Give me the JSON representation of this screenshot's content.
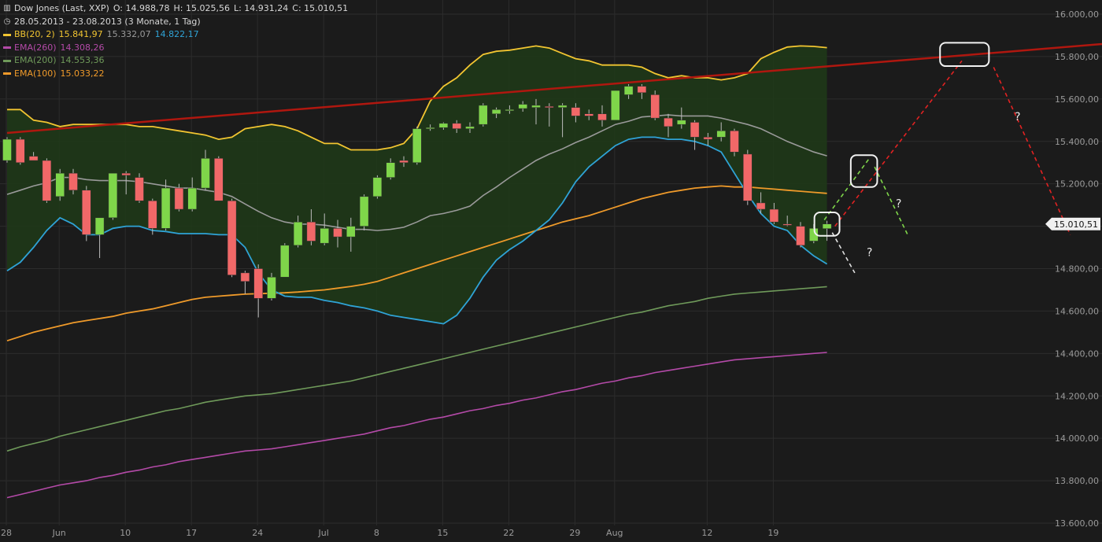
{
  "header": {
    "instrument": "Dow Jones (Last, XXP)",
    "o": "O: 14.988,78",
    "h": "H: 15.025,56",
    "l": "L: 14.931,24",
    "c": "C: 15.010,51",
    "period": "28.05.2013 - 23.08.2013 (3 Monate, 1 Tag)"
  },
  "indicators": [
    {
      "label": "BB(20, 2)",
      "values": [
        "15.841,97",
        "15.332,07",
        "14.822,17"
      ],
      "colors": [
        "#f2c531",
        "#9a9a9a",
        "#2fa3d6"
      ]
    },
    {
      "label": "EMA(260)",
      "values": [
        "14.308,26"
      ],
      "colors": [
        "#b44aa8"
      ]
    },
    {
      "label": "EMA(200)",
      "values": [
        "14.553,36"
      ],
      "colors": [
        "#6f9a5a"
      ]
    },
    {
      "label": "EMA(100)",
      "values": [
        "15.033,22"
      ],
      "colors": [
        "#ef9a2a"
      ]
    }
  ],
  "colors": {
    "background": "#1b1b1b",
    "grid": "#2c2c2c",
    "up": "#7fd64a",
    "down": "#f16868",
    "bb_fill": "#1e3a18",
    "trendline": "#b0170f",
    "scenario_red": "#e32222",
    "scenario_green": "#7fd64a",
    "scenario_white": "#e0e0e0"
  },
  "chart_data": {
    "type": "candlestick",
    "title": "Dow Jones (Last, XXP)",
    "ylim": [
      13560,
      16000
    ],
    "y_ticks": [
      13600,
      13800,
      14000,
      14200,
      14400,
      14600,
      14800,
      15000,
      15200,
      15400,
      15600,
      15800,
      16000
    ],
    "y_tick_labels": [
      "13.600,00",
      "13.800,00",
      "14.000,00",
      "14.200,00",
      "14.400,00",
      "14.600,00",
      "14.800,00",
      "15.000,00",
      "15.200,00",
      "15.400,00",
      "15.600,00",
      "15.800,00",
      "16.000,00"
    ],
    "x_ticks": [
      {
        "label": "28",
        "index": 0
      },
      {
        "label": "Jun",
        "index": 4
      },
      {
        "label": "10",
        "index": 9
      },
      {
        "label": "17",
        "index": 14
      },
      {
        "label": "24",
        "index": 19
      },
      {
        "label": "Jul",
        "index": 24
      },
      {
        "label": "8",
        "index": 28
      },
      {
        "label": "15",
        "index": 33
      },
      {
        "label": "22",
        "index": 38
      },
      {
        "label": "29",
        "index": 43
      },
      {
        "label": "Aug",
        "index": 46
      },
      {
        "label": "12",
        "index": 53
      },
      {
        "label": "19",
        "index": 58
      }
    ],
    "last_price_label": "15.010,51",
    "last_price": 15010.51,
    "candles": [
      {
        "o": 15310,
        "h": 15420,
        "l": 15300,
        "c": 15410
      },
      {
        "o": 15410,
        "h": 15420,
        "l": 15290,
        "c": 15300
      },
      {
        "o": 15330,
        "h": 15350,
        "l": 15310,
        "c": 15310
      },
      {
        "o": 15310,
        "h": 15320,
        "l": 15110,
        "c": 15120
      },
      {
        "o": 15140,
        "h": 15270,
        "l": 15120,
        "c": 15250
      },
      {
        "o": 15250,
        "h": 15270,
        "l": 15150,
        "c": 15170
      },
      {
        "o": 15170,
        "h": 15190,
        "l": 14930,
        "c": 14960
      },
      {
        "o": 14960,
        "h": 15000,
        "l": 14850,
        "c": 15040
      },
      {
        "o": 15040,
        "h": 15250,
        "l": 15030,
        "c": 15250
      },
      {
        "o": 15250,
        "h": 15260,
        "l": 15150,
        "c": 15240
      },
      {
        "o": 15230,
        "h": 15250,
        "l": 15110,
        "c": 15120
      },
      {
        "o": 15120,
        "h": 15130,
        "l": 14960,
        "c": 14990
      },
      {
        "o": 14990,
        "h": 15220,
        "l": 14980,
        "c": 15180
      },
      {
        "o": 15180,
        "h": 15200,
        "l": 15070,
        "c": 15080
      },
      {
        "o": 15080,
        "h": 15230,
        "l": 15070,
        "c": 15180
      },
      {
        "o": 15180,
        "h": 15360,
        "l": 15170,
        "c": 15320
      },
      {
        "o": 15320,
        "h": 15330,
        "l": 15120,
        "c": 15120
      },
      {
        "o": 15120,
        "h": 15130,
        "l": 14760,
        "c": 14770
      },
      {
        "o": 14780,
        "h": 14790,
        "l": 14680,
        "c": 14740
      },
      {
        "o": 14800,
        "h": 14820,
        "l": 14570,
        "c": 14660
      },
      {
        "o": 14660,
        "h": 14780,
        "l": 14650,
        "c": 14760
      },
      {
        "o": 14760,
        "h": 14920,
        "l": 14760,
        "c": 14910
      },
      {
        "o": 14910,
        "h": 15050,
        "l": 14900,
        "c": 15020
      },
      {
        "o": 15020,
        "h": 15080,
        "l": 14910,
        "c": 14930
      },
      {
        "o": 14920,
        "h": 15060,
        "l": 14910,
        "c": 14990
      },
      {
        "o": 14990,
        "h": 15030,
        "l": 14900,
        "c": 14950
      },
      {
        "o": 14950,
        "h": 15040,
        "l": 14880,
        "c": 15000
      },
      {
        "o": 15000,
        "h": 15150,
        "l": 14980,
        "c": 15140
      },
      {
        "o": 15140,
        "h": 15240,
        "l": 15130,
        "c": 15230
      },
      {
        "o": 15230,
        "h": 15320,
        "l": 15220,
        "c": 15300
      },
      {
        "o": 15310,
        "h": 15330,
        "l": 15280,
        "c": 15300
      },
      {
        "o": 15300,
        "h": 15470,
        "l": 15290,
        "c": 15460
      },
      {
        "o": 15460,
        "h": 15480,
        "l": 15450,
        "c": 15465
      },
      {
        "o": 15465,
        "h": 15490,
        "l": 15455,
        "c": 15485
      },
      {
        "o": 15485,
        "h": 15500,
        "l": 15440,
        "c": 15460
      },
      {
        "o": 15460,
        "h": 15490,
        "l": 15440,
        "c": 15470
      },
      {
        "o": 15480,
        "h": 15580,
        "l": 15470,
        "c": 15570
      },
      {
        "o": 15530,
        "h": 15560,
        "l": 15510,
        "c": 15550
      },
      {
        "o": 15545,
        "h": 15570,
        "l": 15530,
        "c": 15550
      },
      {
        "o": 15555,
        "h": 15590,
        "l": 15540,
        "c": 15575
      },
      {
        "o": 15560,
        "h": 15600,
        "l": 15480,
        "c": 15570
      },
      {
        "o": 15565,
        "h": 15580,
        "l": 15470,
        "c": 15560
      },
      {
        "o": 15560,
        "h": 15580,
        "l": 15420,
        "c": 15570
      },
      {
        "o": 15560,
        "h": 15580,
        "l": 15490,
        "c": 15520
      },
      {
        "o": 15530,
        "h": 15550,
        "l": 15500,
        "c": 15520
      },
      {
        "o": 15530,
        "h": 15570,
        "l": 15470,
        "c": 15500
      },
      {
        "o": 15500,
        "h": 15640,
        "l": 15500,
        "c": 15640
      },
      {
        "o": 15620,
        "h": 15670,
        "l": 15600,
        "c": 15660
      },
      {
        "o": 15660,
        "h": 15670,
        "l": 15600,
        "c": 15630
      },
      {
        "o": 15620,
        "h": 15640,
        "l": 15500,
        "c": 15510
      },
      {
        "o": 15510,
        "h": 15530,
        "l": 15420,
        "c": 15470
      },
      {
        "o": 15480,
        "h": 15560,
        "l": 15460,
        "c": 15500
      },
      {
        "o": 15490,
        "h": 15500,
        "l": 15360,
        "c": 15420
      },
      {
        "o": 15420,
        "h": 15440,
        "l": 15380,
        "c": 15410
      },
      {
        "o": 15420,
        "h": 15490,
        "l": 15400,
        "c": 15450
      },
      {
        "o": 15450,
        "h": 15460,
        "l": 15330,
        "c": 15350
      },
      {
        "o": 15340,
        "h": 15360,
        "l": 15100,
        "c": 15120
      },
      {
        "o": 15110,
        "h": 15160,
        "l": 15060,
        "c": 15080
      },
      {
        "o": 15080,
        "h": 15110,
        "l": 15010,
        "c": 15020
      },
      {
        "o": 15010,
        "h": 15050,
        "l": 15000,
        "c": 15005
      },
      {
        "o": 15000,
        "h": 15020,
        "l": 14900,
        "c": 14910
      },
      {
        "o": 14930,
        "h": 15010,
        "l": 14920,
        "c": 14990
      },
      {
        "o": 14988.78,
        "h": 15025.56,
        "l": 14931.24,
        "c": 15010.51
      }
    ],
    "bb_upper": [
      15550,
      15550,
      15500,
      15490,
      15470,
      15480,
      15480,
      15480,
      15480,
      15480,
      15470,
      15470,
      15460,
      15450,
      15440,
      15430,
      15410,
      15420,
      15460,
      15470,
      15480,
      15470,
      15450,
      15420,
      15390,
      15390,
      15360,
      15360,
      15360,
      15370,
      15390,
      15460,
      15590,
      15660,
      15700,
      15760,
      15810,
      15825,
      15830,
      15840,
      15850,
      15840,
      15815,
      15790,
      15780,
      15760,
      15760,
      15760,
      15750,
      15720,
      15700,
      15710,
      15700,
      15700,
      15690,
      15700,
      15720,
      15790,
      15820,
      15845,
      15850,
      15848,
      15842
    ],
    "bb_lower": [
      14790,
      14830,
      14900,
      14980,
      15040,
      15010,
      14960,
      14960,
      14990,
      15000,
      15000,
      14980,
      14975,
      14965,
      14965,
      14965,
      14960,
      14960,
      14900,
      14780,
      14700,
      14670,
      14665,
      14665,
      14650,
      14640,
      14625,
      14615,
      14600,
      14580,
      14570,
      14560,
      14550,
      14540,
      14580,
      14660,
      14760,
      14840,
      14890,
      14930,
      14980,
      15030,
      15110,
      15210,
      15280,
      15330,
      15380,
      15410,
      15420,
      15420,
      15410,
      15410,
      15400,
      15380,
      15350,
      15250,
      15150,
      15060,
      15000,
      14980,
      14910,
      14860,
      14822
    ],
    "bb_mid": [
      15150,
      15170,
      15190,
      15205,
      15230,
      15230,
      15220,
      15215,
      15215,
      15215,
      15210,
      15200,
      15190,
      15180,
      15180,
      15170,
      15160,
      15140,
      15105,
      15070,
      15040,
      15020,
      15010,
      15010,
      15005,
      14995,
      14985,
      14985,
      14980,
      14985,
      14995,
      15020,
      15050,
      15060,
      15075,
      15095,
      15145,
      15185,
      15230,
      15270,
      15310,
      15340,
      15365,
      15395,
      15420,
      15450,
      15480,
      15495,
      15515,
      15520,
      15525,
      15520,
      15520,
      15520,
      15510,
      15495,
      15480,
      15460,
      15430,
      15400,
      15375,
      15350,
      15332
    ],
    "ema100": [
      14460,
      14480,
      14500,
      14515,
      14530,
      14545,
      14555,
      14565,
      14575,
      14590,
      14600,
      14610,
      14625,
      14640,
      14655,
      14665,
      14670,
      14675,
      14680,
      14682,
      14684,
      14686,
      14690,
      14695,
      14700,
      14708,
      14716,
      14726,
      14740,
      14760,
      14780,
      14800,
      14820,
      14840,
      14860,
      14880,
      14900,
      14920,
      14940,
      14960,
      14980,
      15000,
      15020,
      15035,
      15050,
      15070,
      15090,
      15110,
      15130,
      15145,
      15160,
      15170,
      15180,
      15185,
      15190,
      15185,
      15185,
      15180,
      15175,
      15170,
      15165,
      15160,
      15155
    ],
    "ema200": [
      13940,
      13960,
      13975,
      13990,
      14010,
      14025,
      14040,
      14055,
      14070,
      14085,
      14100,
      14115,
      14130,
      14140,
      14155,
      14170,
      14180,
      14190,
      14200,
      14205,
      14210,
      14220,
      14230,
      14240,
      14250,
      14260,
      14270,
      14285,
      14300,
      14315,
      14330,
      14345,
      14360,
      14375,
      14390,
      14405,
      14420,
      14435,
      14450,
      14465,
      14480,
      14495,
      14510,
      14525,
      14540,
      14555,
      14570,
      14585,
      14595,
      14610,
      14625,
      14635,
      14645,
      14660,
      14670,
      14680,
      14685,
      14690,
      14695,
      14700,
      14705,
      14710,
      14715
    ],
    "ema260": [
      13720,
      13735,
      13750,
      13765,
      13780,
      13790,
      13800,
      13815,
      13825,
      13840,
      13850,
      13865,
      13875,
      13890,
      13900,
      13910,
      13920,
      13930,
      13940,
      13945,
      13950,
      13960,
      13970,
      13980,
      13990,
      14000,
      14010,
      14020,
      14035,
      14050,
      14060,
      14075,
      14090,
      14100,
      14115,
      14130,
      14140,
      14155,
      14165,
      14180,
      14190,
      14205,
      14220,
      14230,
      14245,
      14260,
      14270,
      14285,
      14295,
      14310,
      14320,
      14330,
      14340,
      14350,
      14360,
      14370,
      14375,
      14380,
      14385,
      14390,
      14395,
      14400,
      14405
    ],
    "trendline": {
      "from": {
        "index": 0,
        "price": 15440
      },
      "to": {
        "index": 83,
        "price": 15860
      }
    },
    "scenarios": {
      "red": [
        {
          "index": 62.6,
          "price": 15000
        },
        {
          "index": 72.2,
          "price": 15780
        },
        {
          "index": 74.6,
          "price": 15750
        },
        {
          "index": 80.4,
          "price": 14960
        }
      ],
      "green": [
        {
          "index": 61.8,
          "price": 15030
        },
        {
          "index": 65.2,
          "price": 15320
        },
        {
          "index": 65.6,
          "price": 15280
        },
        {
          "index": 68.1,
          "price": 14960
        }
      ],
      "white": [
        {
          "index": 62.4,
          "price": 14970
        },
        {
          "index": 64.1,
          "price": 14780
        }
      ],
      "boxes": [
        {
          "index": 62.0,
          "price": 15010,
          "w": 1.9,
          "h": 110
        },
        {
          "index": 64.8,
          "price": 15260,
          "w": 2.0,
          "h": 150
        },
        {
          "index": 72.4,
          "price": 15810,
          "w": 3.7,
          "h": 110
        }
      ],
      "question_marks": [
        {
          "text": "?",
          "index": 65.0,
          "price": 14860
        },
        {
          "text": "?",
          "index": 67.2,
          "price": 15090
        },
        {
          "text": "?",
          "index": 76.2,
          "price": 15500
        }
      ]
    }
  }
}
